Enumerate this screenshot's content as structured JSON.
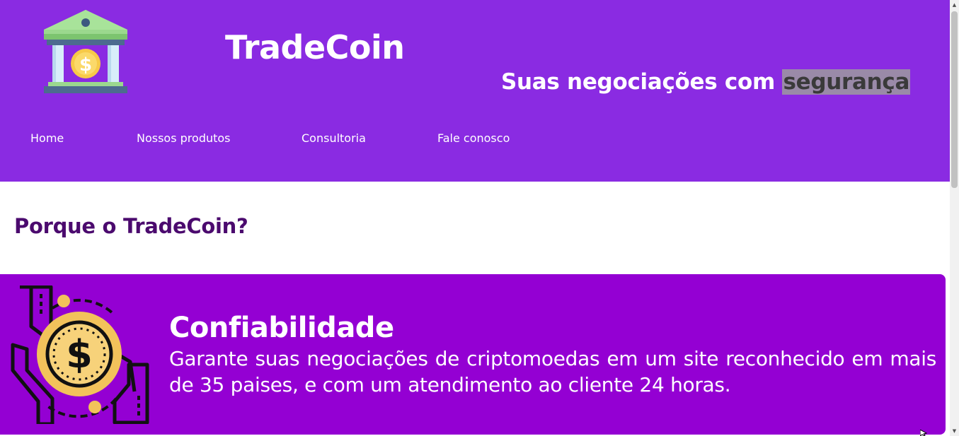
{
  "header": {
    "brand": "TradeCoin",
    "slogan_prefix": "Suas negociações com",
    "slogan_highlight": "segurança",
    "logo_icon": "bank-coin-icon"
  },
  "nav": {
    "items": [
      {
        "label": "Home"
      },
      {
        "label": "Nossos produtos"
      },
      {
        "label": "Consultoria"
      },
      {
        "label": "Fale conosco"
      }
    ]
  },
  "main": {
    "section_title": "Porque o TradeCoin?",
    "features": [
      {
        "icon": "hands-coin-icon",
        "title": "Confiabilidade",
        "text": "Garante suas negociações de criptomoedas em um site reconhecido em mais de 35 paises, e com um atendimento ao cliente 24 horas."
      }
    ]
  },
  "colors": {
    "header_bg": "#8a2be2",
    "card_bg": "#9400d3",
    "title_color": "#4b0a6e",
    "highlight_bg": "#9a8aa8"
  }
}
